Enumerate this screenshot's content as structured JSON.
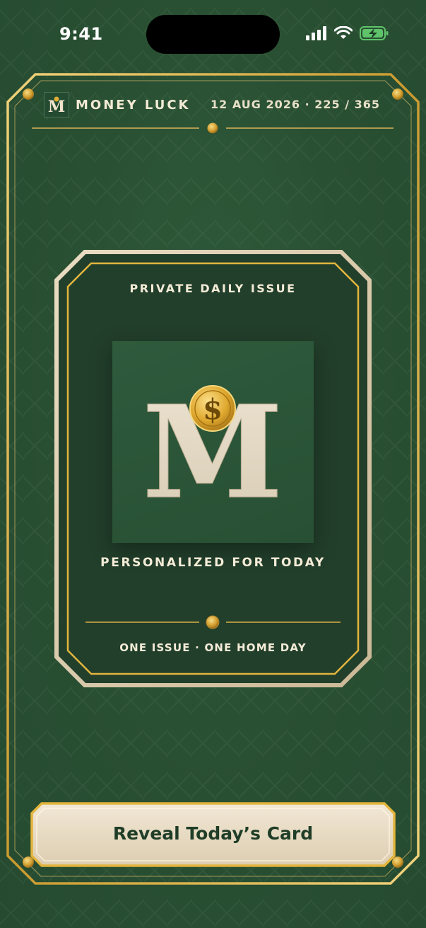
{
  "status_bar": {
    "time": "9:41"
  },
  "header": {
    "brand": "MONEY LUCK",
    "logo_letter": "M",
    "date_info": "12 AUG 2026 · 225 / 365"
  },
  "card": {
    "top_label": "PRIVATE DAILY ISSUE",
    "emblem_letter": "M",
    "coin_symbol": "$",
    "subtitle": "PERSONALIZED FOR TODAY",
    "footer_label": "ONE ISSUE · ONE HOME DAY"
  },
  "cta": {
    "label": "Reveal Today’s Card"
  },
  "colors": {
    "background": "#2a5033",
    "gold": "#d9a83a",
    "cream": "#efe3cc",
    "dark_green_text": "#1f3d27"
  }
}
